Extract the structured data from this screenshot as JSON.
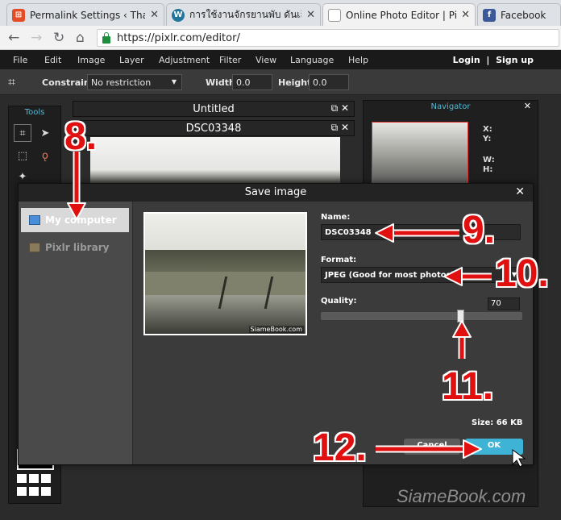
{
  "browser": {
    "tabs": [
      {
        "title": "Permalink Settings ‹ Thai",
        "favicon": "wordpress-orange",
        "color": "#e44d26"
      },
      {
        "title": "การใช้งานจักรยานพับ ดันเล็ก",
        "favicon": "wordpress",
        "color": "#21759b"
      },
      {
        "title": "Online Photo Editor | Pixl",
        "favicon": "page",
        "color": "#ffffff"
      },
      {
        "title": "Facebook",
        "favicon": "facebook",
        "color": "#3b5998"
      }
    ],
    "url": "https://pixlr.com/editor/"
  },
  "menu": {
    "items": [
      "File",
      "Edit",
      "Image",
      "Layer",
      "Adjustment",
      "Filter",
      "View",
      "Language",
      "Help"
    ],
    "login": "Login",
    "separator": "|",
    "signup": "Sign up"
  },
  "options": {
    "constraint_label": "Constraint:",
    "constraint_value": "No restriction",
    "width_label": "Width:",
    "width_value": "0.0",
    "height_label": "Height:",
    "height_value": "0.0"
  },
  "panels": {
    "tools_title": "Tools",
    "doc1_title": "Untitled",
    "doc2_title": "DSC03348",
    "navigator_title": "Navigator",
    "nav_labels": [
      "X:",
      "Y:",
      "W:",
      "H:"
    ]
  },
  "dialog": {
    "title": "Save image",
    "locations": [
      "My computer",
      "Pixlr library"
    ],
    "image_credit": "SiameBook.com",
    "name_label": "Name:",
    "name_value": "DSC03348",
    "format_label": "Format:",
    "format_value": "JPEG (Good for most photos)",
    "quality_label": "Quality:",
    "quality_value": "70",
    "quality_fraction": 0.7,
    "size_text": "Size:  66 KB",
    "cancel_label": "Cancel",
    "ok_label": "OK"
  },
  "annotations": {
    "step8": "8.",
    "step9": "9.",
    "step10": "10.",
    "step11": "11.",
    "step12": "12.",
    "color": "#e01010"
  },
  "watermark": "SiameBook.com"
}
